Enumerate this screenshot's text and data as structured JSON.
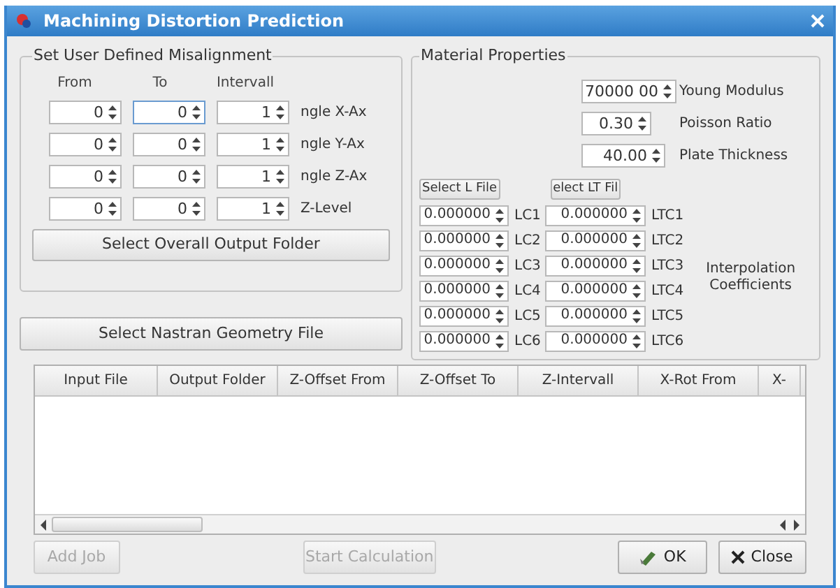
{
  "window": {
    "title": "Machining Distortion Prediction"
  },
  "misalignment": {
    "title": "Set User Defined Misalignment",
    "headers": [
      "From",
      "To",
      "Intervall"
    ],
    "rows": [
      {
        "from": "0",
        "to": "0",
        "interval": "1",
        "label": "ngle X-Ax",
        "to_focused": true
      },
      {
        "from": "0",
        "to": "0",
        "interval": "1",
        "label": "ngle Y-Ax",
        "to_focused": false
      },
      {
        "from": "0",
        "to": "0",
        "interval": "1",
        "label": "ngle Z-Ax",
        "to_focused": false
      },
      {
        "from": "0",
        "to": "0",
        "interval": "1",
        "label": "Z-Level",
        "to_focused": false
      }
    ],
    "button": "Select Overall Output Folder"
  },
  "nastran_button": "Select Nastran Geometry File",
  "material": {
    "title": "Material Properties",
    "properties": [
      {
        "value": "70000 00",
        "label": "Young Modulus"
      },
      {
        "value": "0.30",
        "label": "Poisson Ratio"
      },
      {
        "value": "40.00",
        "label": "Plate Thickness"
      }
    ],
    "l_file_button": "Select L File",
    "lt_file_button": "elect LT Fil",
    "coefficients": [
      {
        "lc_value": "0.000000",
        "lc_label": "LC1",
        "ltc_value": "0.000000",
        "ltc_label": "LTC1"
      },
      {
        "lc_value": "0.000000",
        "lc_label": "LC2",
        "ltc_value": "0.000000",
        "ltc_label": "LTC2"
      },
      {
        "lc_value": "0.000000",
        "lc_label": "LC3",
        "ltc_value": "0.000000",
        "ltc_label": "LTC3"
      },
      {
        "lc_value": "0.000000",
        "lc_label": "LC4",
        "ltc_value": "0.000000",
        "ltc_label": "LTC4"
      },
      {
        "lc_value": "0.000000",
        "lc_label": "LC5",
        "ltc_value": "0.000000",
        "ltc_label": "LTC5"
      },
      {
        "lc_value": "0.000000",
        "lc_label": "LC6",
        "ltc_value": "0.000000",
        "ltc_label": "LTC6"
      }
    ],
    "interpolation_label": "Interpolation Coefficients"
  },
  "table": {
    "columns": [
      "Input File",
      "Output Folder",
      "Z-Offset From",
      "Z-Offset To",
      "Z-Intervall",
      "X-Rot From",
      "X-"
    ]
  },
  "buttons": [
    {
      "label": "Add Job",
      "kind": "plain",
      "disabled": true
    },
    {
      "label": "Start Calculation",
      "kind": "plain",
      "disabled": true
    },
    {
      "label": "OK",
      "kind": "ok",
      "disabled": false
    },
    {
      "label": "Close",
      "kind": "close",
      "disabled": false
    }
  ]
}
